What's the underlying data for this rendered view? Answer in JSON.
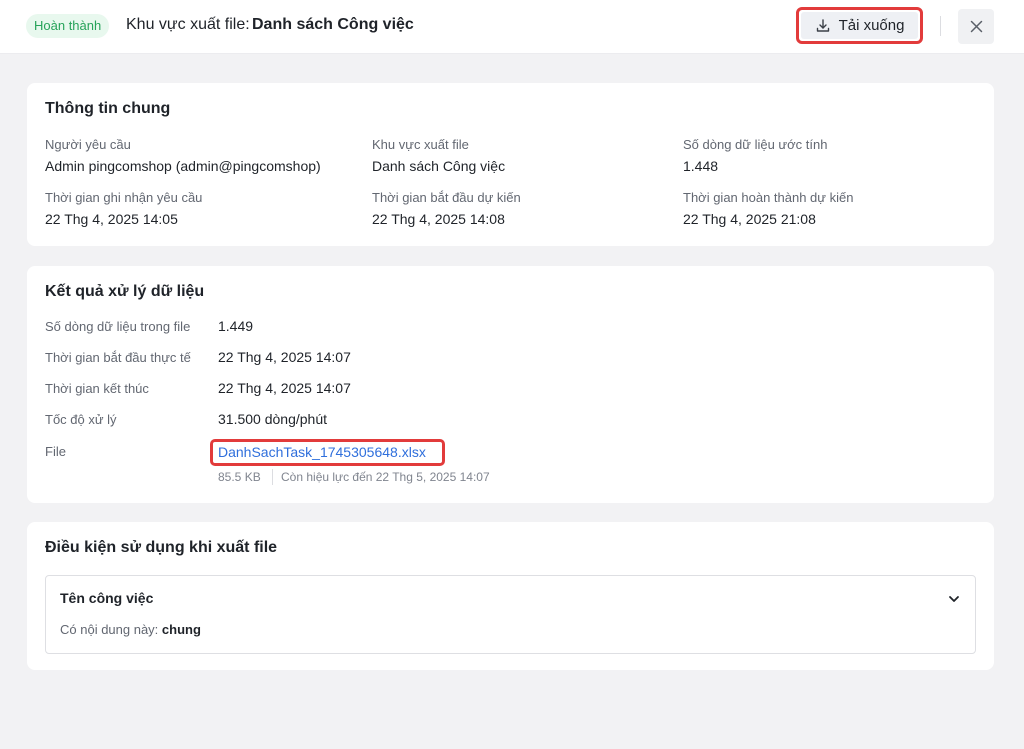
{
  "header": {
    "status": "Hoàn thành",
    "title_prefix": "Khu vực xuất file:",
    "title_name": "Danh sách Công việc",
    "download_label": "Tải xuống"
  },
  "general": {
    "title": "Thông tin chung",
    "fields": [
      {
        "label": "Người yêu cầu",
        "value": "Admin pingcomshop (admin@pingcomshop)"
      },
      {
        "label": "Khu vực xuất file",
        "value": "Danh sách Công việc"
      },
      {
        "label": "Số dòng dữ liệu ước tính",
        "value": "1.448"
      },
      {
        "label": "Thời gian ghi nhận yêu cầu",
        "value": "22 Thg 4, 2025 14:05"
      },
      {
        "label": "Thời gian bắt đầu dự kiến",
        "value": "22 Thg 4, 2025 14:08"
      },
      {
        "label": "Thời gian hoàn thành dự kiến",
        "value": "22 Thg 4, 2025 21:08"
      }
    ]
  },
  "result": {
    "title": "Kết quả xử lý dữ liệu",
    "rows": [
      {
        "label": "Số dòng dữ liệu trong file",
        "value": "1.449"
      },
      {
        "label": "Thời gian bắt đầu thực tế",
        "value": "22 Thg 4, 2025 14:07"
      },
      {
        "label": "Thời gian kết thúc",
        "value": "22 Thg 4, 2025 14:07"
      },
      {
        "label": "Tốc độ xử lý",
        "value": "31.500 dòng/phút"
      }
    ],
    "file_label": "File",
    "file_name": "DanhSachTask_1745305648.xlsx",
    "file_size": "85.5 KB",
    "file_expiry": "Còn hiệu lực đến 22 Thg 5, 2025 14:07"
  },
  "conditions": {
    "title": "Điều kiện sử dụng khi xuất file",
    "item_name": "Tên công việc",
    "item_text": "Có nội dung này:",
    "item_value": "chung"
  },
  "colors": {
    "status_green": "#27a35a",
    "link_blue": "#2f6fdc",
    "highlight_red": "#e23b3b"
  }
}
